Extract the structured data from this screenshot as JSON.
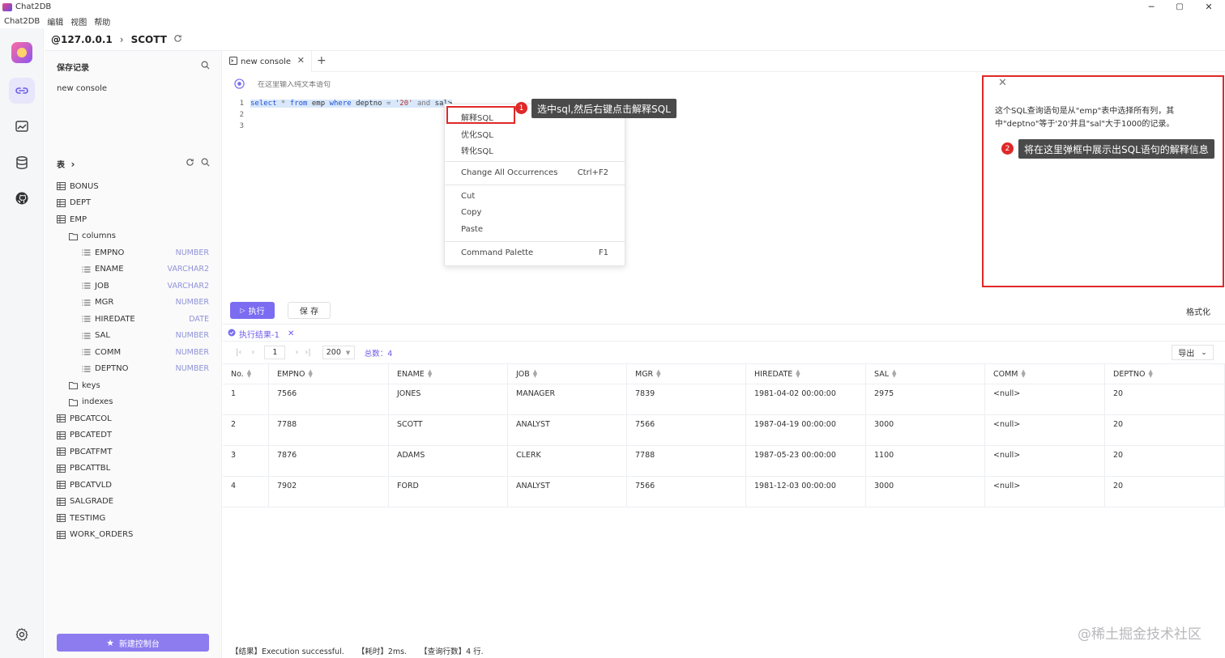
{
  "window": {
    "title": "Chat2DB",
    "minimize": "─",
    "maximize": "▢",
    "close": "✕"
  },
  "menu": [
    "Chat2DB",
    "编辑",
    "视图",
    "帮助"
  ],
  "breadcrumb": {
    "host": "@127.0.0.1",
    "separator": "›",
    "database": "SCOTT"
  },
  "sidebar": {
    "saved_title": "保存记录",
    "saved_items": [
      "new console"
    ],
    "tables_title": "表",
    "tables_chevron": "›",
    "tree": [
      {
        "label": "BONUS",
        "type": "table",
        "level": 0
      },
      {
        "label": "DEPT",
        "type": "table",
        "level": 0
      },
      {
        "label": "EMP",
        "type": "table",
        "level": 0
      },
      {
        "label": "columns",
        "type": "folder",
        "level": 1
      },
      {
        "label": "EMPNO",
        "type": "column",
        "level": 2,
        "dtype": "NUMBER"
      },
      {
        "label": "ENAME",
        "type": "column",
        "level": 2,
        "dtype": "VARCHAR2"
      },
      {
        "label": "JOB",
        "type": "column",
        "level": 2,
        "dtype": "VARCHAR2"
      },
      {
        "label": "MGR",
        "type": "column",
        "level": 2,
        "dtype": "NUMBER"
      },
      {
        "label": "HIREDATE",
        "type": "column",
        "level": 2,
        "dtype": "DATE"
      },
      {
        "label": "SAL",
        "type": "column",
        "level": 2,
        "dtype": "NUMBER"
      },
      {
        "label": "COMM",
        "type": "column",
        "level": 2,
        "dtype": "NUMBER"
      },
      {
        "label": "DEPTNO",
        "type": "column",
        "level": 2,
        "dtype": "NUMBER"
      },
      {
        "label": "keys",
        "type": "folder",
        "level": 1
      },
      {
        "label": "indexes",
        "type": "folder",
        "level": 1
      },
      {
        "label": "PBCATCOL",
        "type": "table",
        "level": 0
      },
      {
        "label": "PBCATEDT",
        "type": "table",
        "level": 0
      },
      {
        "label": "PBCATFMT",
        "type": "table",
        "level": 0
      },
      {
        "label": "PBCATTBL",
        "type": "table",
        "level": 0
      },
      {
        "label": "PBCATVLD",
        "type": "table",
        "level": 0
      },
      {
        "label": "SALGRADE",
        "type": "table",
        "level": 0
      },
      {
        "label": "TESTIMG",
        "type": "table",
        "level": 0
      },
      {
        "label": "WORK_ORDERS",
        "type": "table",
        "level": 0
      }
    ],
    "new_console_label": "新建控制台"
  },
  "tabs": [
    {
      "label": "new console",
      "close": "✕"
    }
  ],
  "tab_add": "+",
  "ai_input_placeholder": "在这里输入纯文本语句",
  "editor": {
    "line_numbers": [
      "1",
      "2",
      "3"
    ],
    "tokens": [
      {
        "t": "select",
        "c": "kw"
      },
      {
        "t": " * ",
        "c": "op"
      },
      {
        "t": "from",
        "c": "kw"
      },
      {
        "t": " emp ",
        "c": "idf"
      },
      {
        "t": "where",
        "c": "kw"
      },
      {
        "t": " deptno ",
        "c": "idf"
      },
      {
        "t": "=",
        "c": "op"
      },
      {
        "t": " '20' ",
        "c": "str"
      },
      {
        "t": "and",
        "c": "op"
      },
      {
        "t": " sal>",
        "c": "idf"
      }
    ]
  },
  "context_menu": {
    "explain": "解释SQL",
    "optimize": "优化SQL",
    "convert": "转化SQL",
    "change_all": "Change All Occurrences",
    "change_all_shortcut": "Ctrl+F2",
    "cut": "Cut",
    "copy": "Copy",
    "paste": "Paste",
    "palette": "Command Palette",
    "palette_shortcut": "F1"
  },
  "callouts": {
    "one_badge": "1",
    "one_text": "选中sql,然后右键点击解释SQL",
    "two_badge": "2",
    "two_text": "将在这里弹框中展示出SQL语句的解释信息"
  },
  "explain_panel": {
    "close": "✕",
    "text": "这个SQL查询语句是从\"emp\"表中选择所有列，其中\"deptno\"等于'20'并且\"sal\"大于1000的记录。"
  },
  "actions": {
    "run": "执行",
    "save": "保 存",
    "format": "格式化"
  },
  "results": {
    "tab_label": "执行结果-1",
    "tab_close": "✕",
    "pager": {
      "first": "|‹",
      "prev": "‹",
      "page": "1",
      "next": "›",
      "last": "›|",
      "size": "200",
      "total": "总数：4"
    },
    "export": "导出",
    "columns": [
      "No.",
      "EMPNO",
      "ENAME",
      "JOB",
      "MGR",
      "HIREDATE",
      "SAL",
      "COMM",
      "DEPTNO"
    ],
    "rows": [
      [
        "1",
        "7566",
        "JONES",
        "MANAGER",
        "7839",
        "1981-04-02 00:00:00",
        "2975",
        "<null>",
        "20"
      ],
      [
        "2",
        "7788",
        "SCOTT",
        "ANALYST",
        "7566",
        "1987-04-19 00:00:00",
        "3000",
        "<null>",
        "20"
      ],
      [
        "3",
        "7876",
        "ADAMS",
        "CLERK",
        "7788",
        "1987-05-23 00:00:00",
        "1100",
        "<null>",
        "20"
      ],
      [
        "4",
        "7902",
        "FORD",
        "ANALYST",
        "7566",
        "1981-12-03 00:00:00",
        "3000",
        "<null>",
        "20"
      ]
    ]
  },
  "status": {
    "result": "【结果】Execution successful.",
    "time": "【耗时】2ms.",
    "rows": "【查询行数】4 行."
  },
  "watermark": "@稀土掘金技术社区",
  "colors": {
    "accent": "#7b6cf2",
    "annotation": "#e02828"
  }
}
